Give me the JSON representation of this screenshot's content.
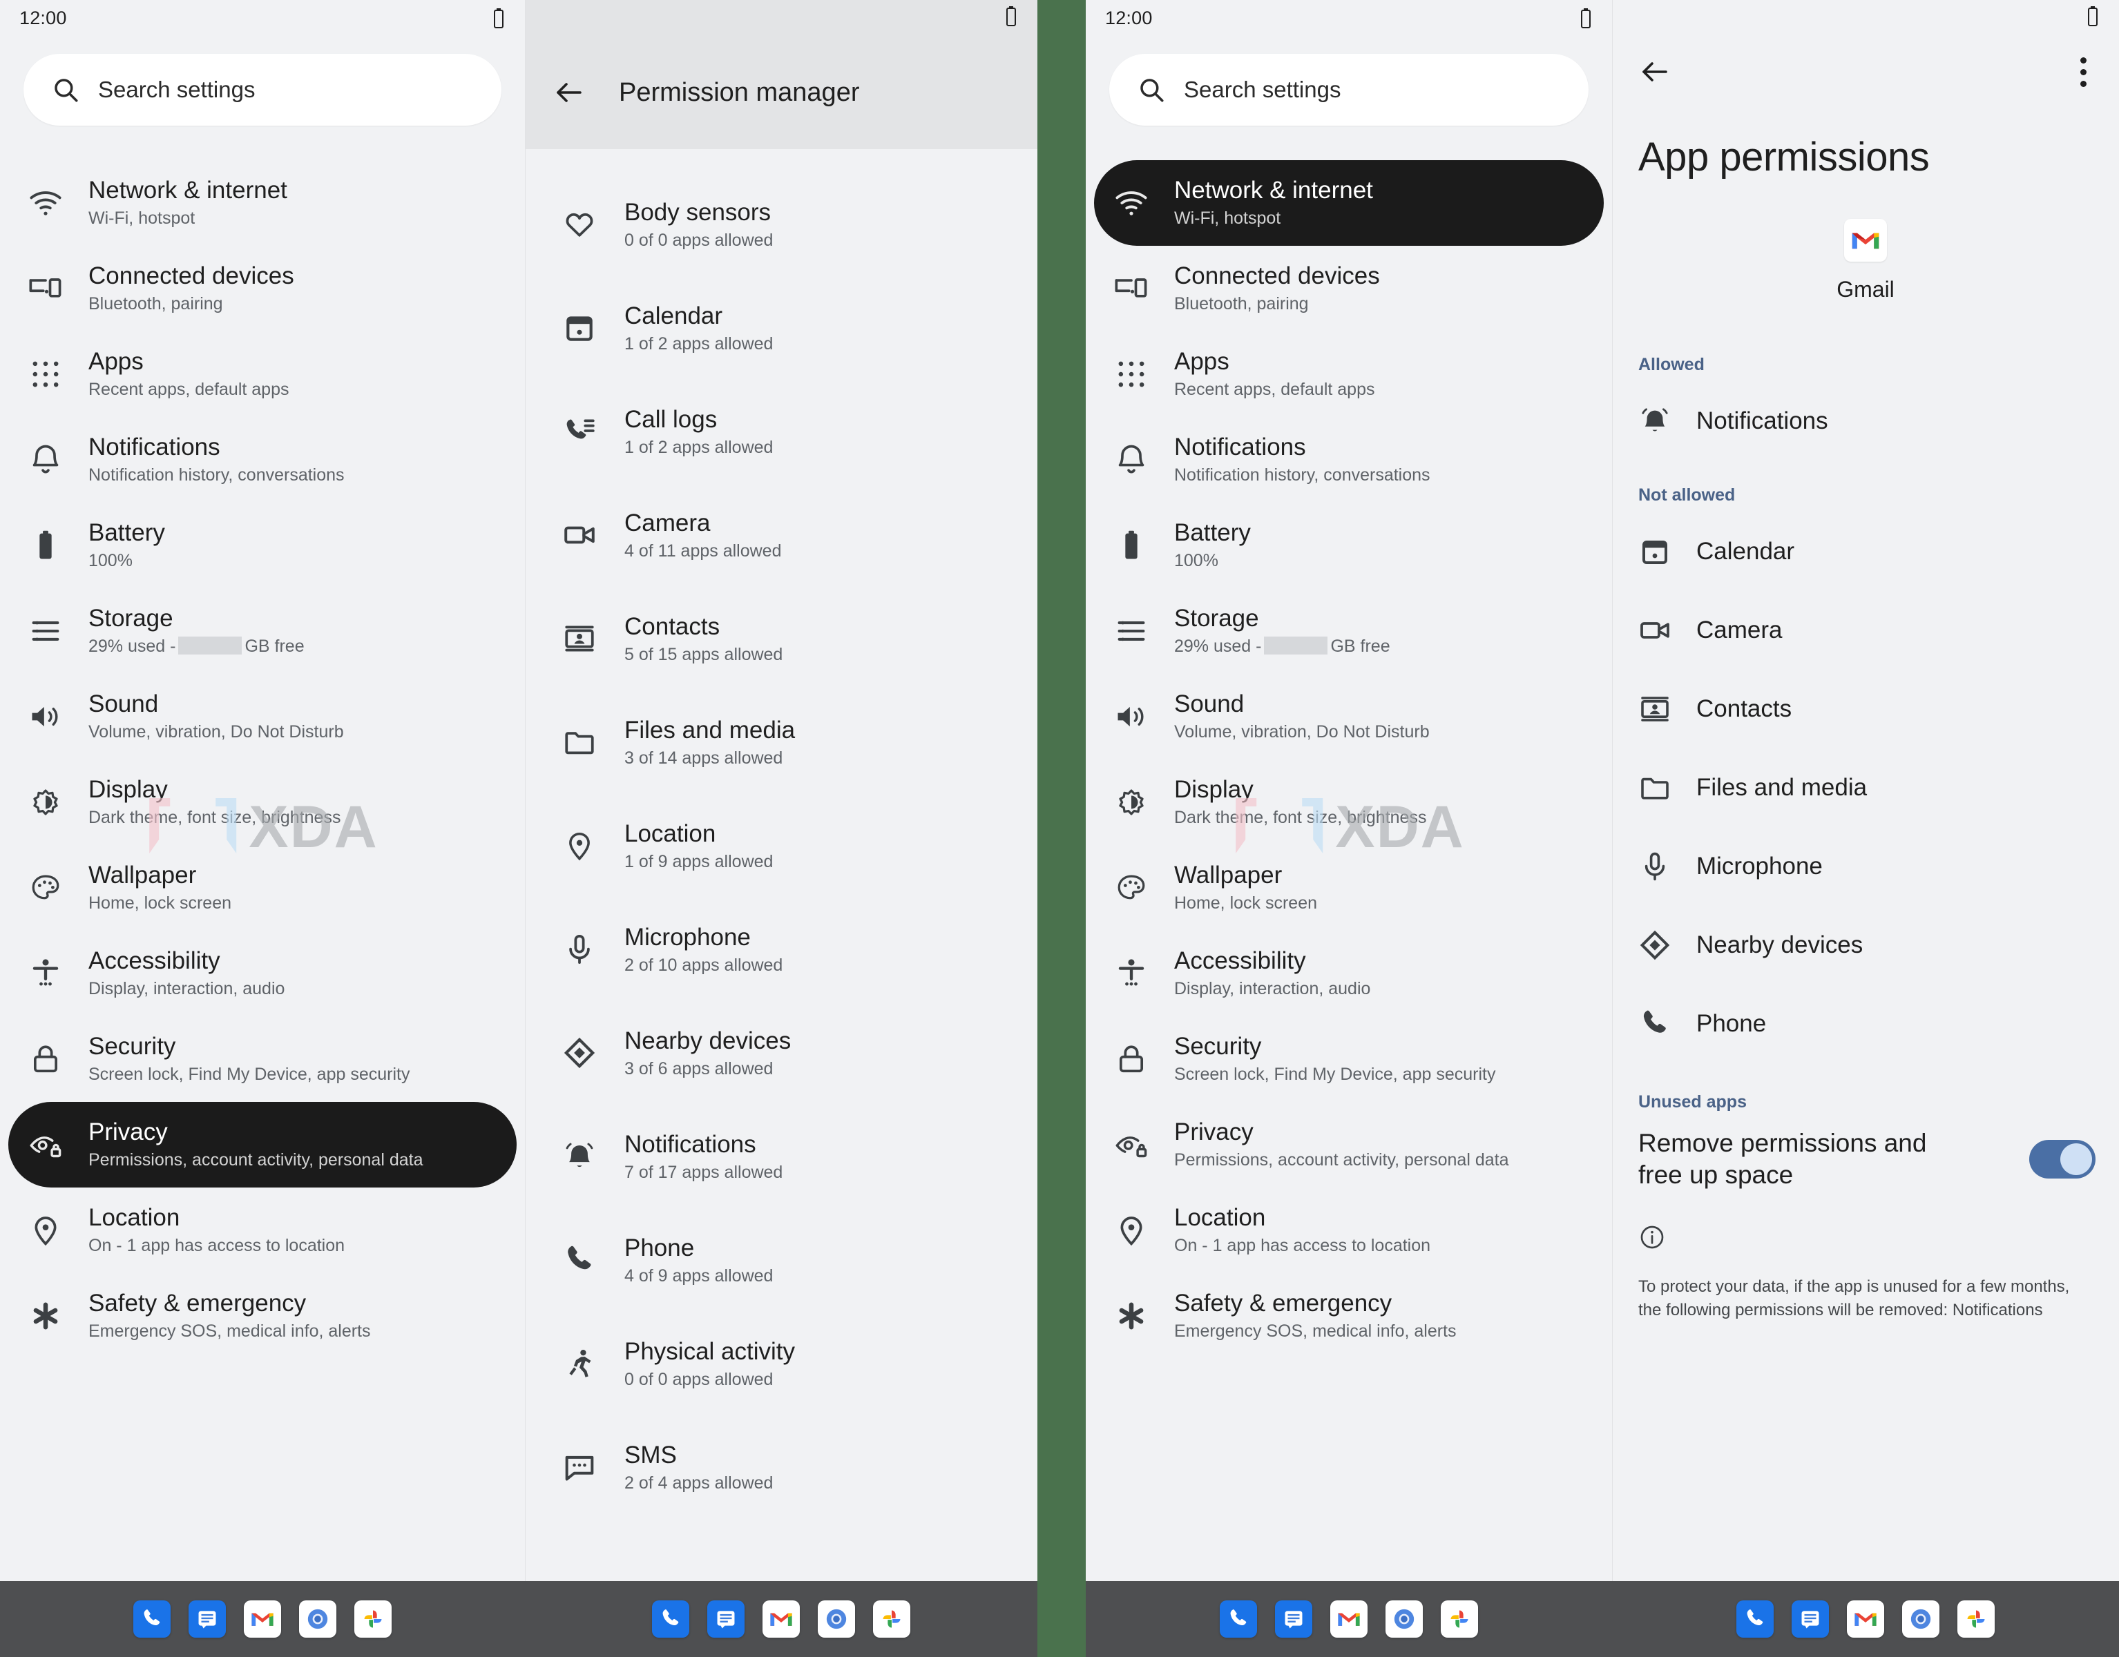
{
  "status": {
    "time": "12:00",
    "battery_icon": "battery-icon"
  },
  "search": {
    "placeholder": "Search settings",
    "icon": "search-icon"
  },
  "settings_list": [
    {
      "icon": "wifi-icon",
      "title": "Network & internet",
      "subtitle": "Wi-Fi, hotspot"
    },
    {
      "icon": "connected-devices-icon",
      "title": "Connected devices",
      "subtitle": "Bluetooth, pairing"
    },
    {
      "icon": "apps-grid-icon",
      "title": "Apps",
      "subtitle": "Recent apps, default apps"
    },
    {
      "icon": "bell-icon",
      "title": "Notifications",
      "subtitle": "Notification history, conversations"
    },
    {
      "icon": "battery-icon",
      "title": "Battery",
      "subtitle": "100%"
    },
    {
      "icon": "storage-icon",
      "title": "Storage",
      "subtitle_prefix": "29% used -",
      "subtitle_suffix": "GB free",
      "redacted": true
    },
    {
      "icon": "volume-icon",
      "title": "Sound",
      "subtitle": "Volume, vibration, Do Not Disturb"
    },
    {
      "icon": "display-icon",
      "title": "Display",
      "subtitle": "Dark theme, font size, brightness"
    },
    {
      "icon": "palette-icon",
      "title": "Wallpaper",
      "subtitle": "Home, lock screen"
    },
    {
      "icon": "accessibility-icon",
      "title": "Accessibility",
      "subtitle": "Display, interaction, audio"
    },
    {
      "icon": "lock-icon",
      "title": "Security",
      "subtitle": "Screen lock, Find My Device, app security"
    },
    {
      "icon": "privacy-eye-icon",
      "title": "Privacy",
      "subtitle": "Permissions, account activity, personal data"
    },
    {
      "icon": "location-pin-icon",
      "title": "Location",
      "subtitle": "On - 1 app has access to location"
    },
    {
      "icon": "safety-asterisk-icon",
      "title": "Safety & emergency",
      "subtitle": "Emergency SOS, medical info, alerts"
    }
  ],
  "left_device": {
    "selected_index": 11,
    "permission_manager": {
      "back_icon": "back-arrow-icon",
      "title": "Permission manager",
      "items": [
        {
          "icon": "heart-icon",
          "title": "Body sensors",
          "subtitle": "0 of 0 apps allowed"
        },
        {
          "icon": "calendar-icon",
          "title": "Calendar",
          "subtitle": "1 of 2 apps allowed"
        },
        {
          "icon": "call-log-icon",
          "title": "Call logs",
          "subtitle": "1 of 2 apps allowed"
        },
        {
          "icon": "camera-icon",
          "title": "Camera",
          "subtitle": "4 of 11 apps allowed"
        },
        {
          "icon": "contacts-icon",
          "title": "Contacts",
          "subtitle": "5 of 15 apps allowed"
        },
        {
          "icon": "folder-icon",
          "title": "Files and media",
          "subtitle": "3 of 14 apps allowed"
        },
        {
          "icon": "location-pin-icon",
          "title": "Location",
          "subtitle": "1 of 9 apps allowed"
        },
        {
          "icon": "microphone-icon",
          "title": "Microphone",
          "subtitle": "2 of 10 apps allowed"
        },
        {
          "icon": "nearby-devices-icon",
          "title": "Nearby devices",
          "subtitle": "3 of 6 apps allowed"
        },
        {
          "icon": "bell-ring-icon",
          "title": "Notifications",
          "subtitle": "7 of 17 apps allowed"
        },
        {
          "icon": "phone-icon",
          "title": "Phone",
          "subtitle": "4 of 9 apps allowed"
        },
        {
          "icon": "running-icon",
          "title": "Physical activity",
          "subtitle": "0 of 0 apps allowed"
        },
        {
          "icon": "sms-icon",
          "title": "SMS",
          "subtitle": "2 of 4 apps allowed"
        }
      ]
    }
  },
  "right_device": {
    "selected_index": 0,
    "app_permissions": {
      "back_icon": "back-arrow-icon",
      "overflow_icon": "kebab-menu-icon",
      "title": "App permissions",
      "app_name": "Gmail",
      "app_icon": "gmail-icon",
      "sections": [
        {
          "label": "Allowed",
          "items": [
            {
              "icon": "bell-ring-icon",
              "label": "Notifications"
            }
          ]
        },
        {
          "label": "Not allowed",
          "items": [
            {
              "icon": "calendar-icon",
              "label": "Calendar"
            },
            {
              "icon": "camera-icon",
              "label": "Camera"
            },
            {
              "icon": "contacts-icon",
              "label": "Contacts"
            },
            {
              "icon": "folder-icon",
              "label": "Files and media"
            },
            {
              "icon": "microphone-icon",
              "label": "Microphone"
            },
            {
              "icon": "nearby-devices-icon",
              "label": "Nearby devices"
            },
            {
              "icon": "phone-icon",
              "label": "Phone"
            }
          ]
        }
      ],
      "unused_apps": {
        "section_label": "Unused apps",
        "toggle_label": "Remove permissions and free up space",
        "toggle_on": true,
        "info_icon": "info-icon",
        "note": "To protect your data, if the app is unused for a few months, the following permissions will be removed: Notifications"
      }
    }
  },
  "dock": {
    "apps": [
      {
        "name": "phone-app-icon",
        "style": "blue"
      },
      {
        "name": "messages-app-icon",
        "style": "blue"
      },
      {
        "name": "gmail-app-icon",
        "style": "white"
      },
      {
        "name": "chrome-app-icon",
        "style": "white"
      },
      {
        "name": "photos-app-icon",
        "style": "white"
      }
    ]
  },
  "watermark": {
    "text": "XDA"
  },
  "colors": {
    "background": "#f1f2f4",
    "selected_row": "#1b1b1b",
    "section_label": "#4a6287",
    "toggle_on": "#4a6fa5",
    "divider_green": "#4a724d",
    "dock": "#4e4f51"
  }
}
